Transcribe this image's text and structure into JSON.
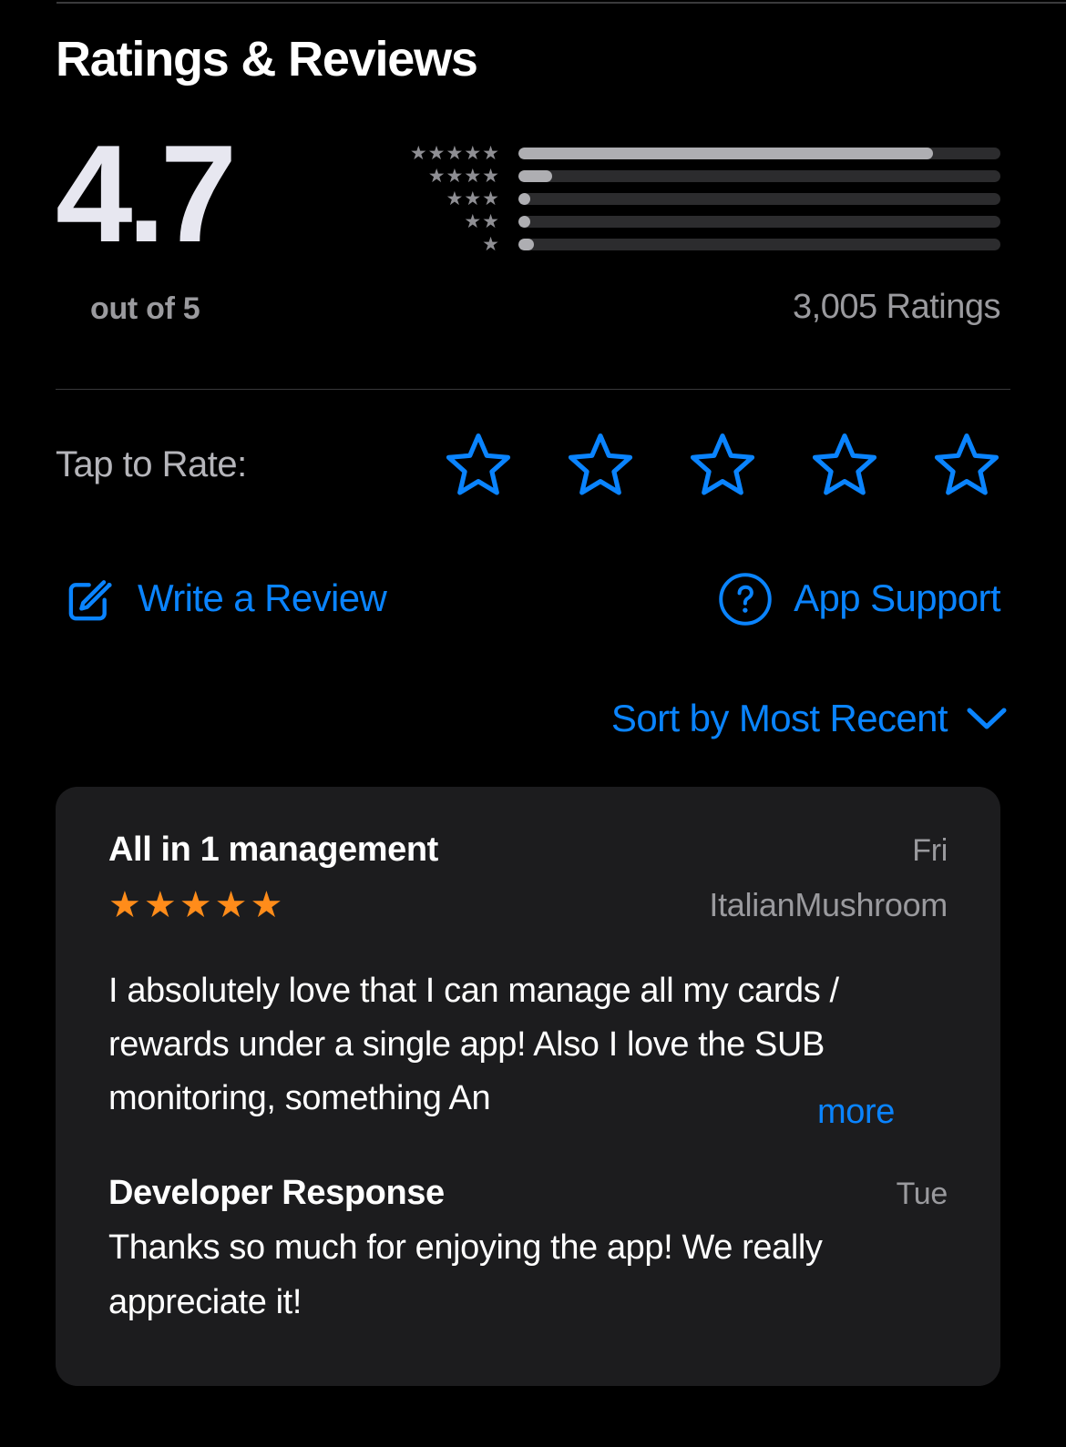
{
  "section": {
    "title": "Ratings & Reviews"
  },
  "summary": {
    "score": "4.7",
    "out_of_label": "out of 5",
    "ratings_count_label": "3,005 Ratings",
    "histogram": [
      {
        "stars_glyphs": "★★★★★",
        "percent": 86
      },
      {
        "stars_glyphs": "★★★★",
        "percent": 7
      },
      {
        "stars_glyphs": "★★★",
        "percent": 1.6
      },
      {
        "stars_glyphs": "★★",
        "percent": 1.0
      },
      {
        "stars_glyphs": "★",
        "percent": 3.2
      }
    ]
  },
  "tap_to_rate": {
    "label": "Tap to Rate:",
    "star_count": 5,
    "filled": 0
  },
  "actions": {
    "write_review_label": "Write a Review",
    "app_support_label": "App Support"
  },
  "sort": {
    "label": "Sort by Most Recent"
  },
  "review": {
    "title": "All in 1 management",
    "date": "Fri",
    "stars_glyphs": "★★★★★",
    "rating": 5,
    "author": "ItalianMushroom",
    "body": "I absolutely love that I can manage all my cards / rewards under a single app! Also I love the SUB monitoring, something An",
    "more_label": "more",
    "developer_response": {
      "title": "Developer Response",
      "date": "Tue",
      "body": "Thanks so much for enjoying the app! We really appreciate it!"
    }
  },
  "colors": {
    "background": "#000000",
    "card": "#1c1c1e",
    "accent_blue": "#0a84ff",
    "star_orange": "#ff8c1a",
    "bar_fill": "#aeaeb2",
    "bar_track": "#2c2c2e",
    "secondary_text": "#9a9a9e",
    "score_text": "#e7e7f0"
  }
}
